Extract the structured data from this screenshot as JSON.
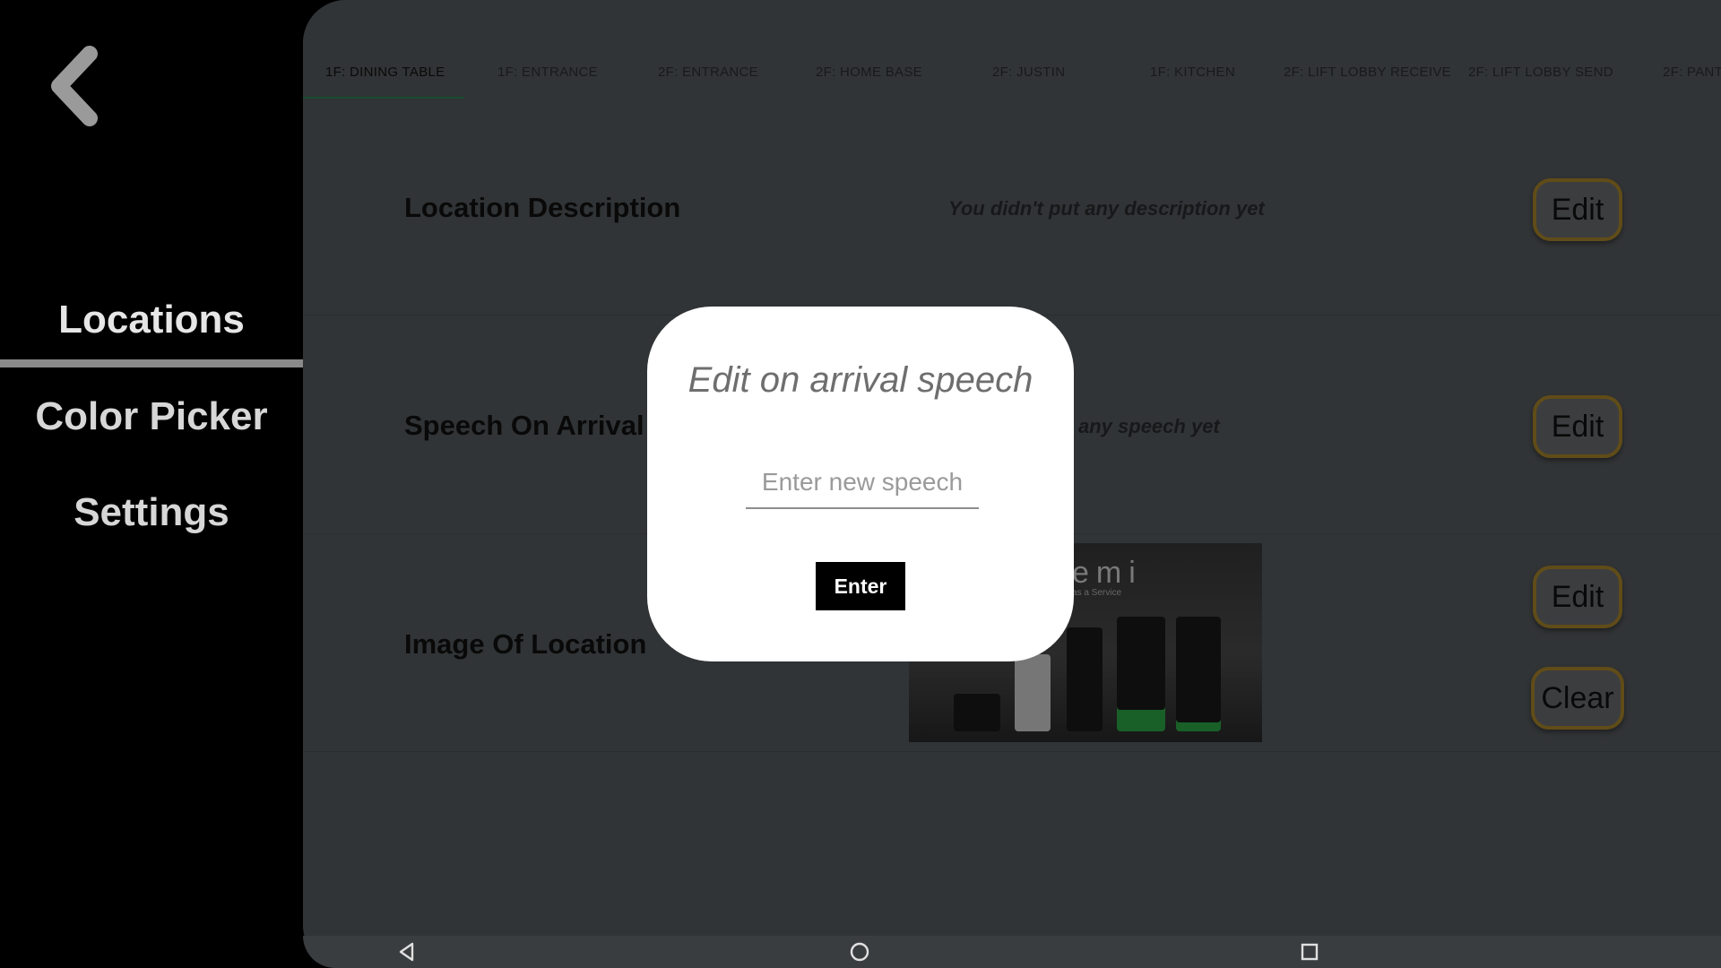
{
  "sidebar": {
    "items": [
      {
        "label": "Locations"
      },
      {
        "label": "Color Picker"
      },
      {
        "label": "Settings"
      }
    ]
  },
  "tabs": [
    {
      "label": "1F: Dining Table"
    },
    {
      "label": "1F: Entrance"
    },
    {
      "label": "2F: Entrance"
    },
    {
      "label": "2F: Home Base"
    },
    {
      "label": "2F: Justin"
    },
    {
      "label": "1F: Kitchen"
    },
    {
      "label": "2F: Lift Lobby Receive"
    },
    {
      "label": "2F: Lift Lobby Send"
    },
    {
      "label": "2F: Pant"
    }
  ],
  "rows": {
    "description": {
      "label": "Location Description",
      "value": "You didn't put any description yet",
      "edit_label": "Edit"
    },
    "speech": {
      "label": "Speech On Arrival",
      "value": "any speech yet",
      "edit_label": "Edit"
    },
    "image": {
      "label": "Image Of Location",
      "edit_label": "Edit",
      "clear_label": "Clear",
      "image_text": "emi",
      "image_subtext": "as a Service"
    }
  },
  "dialog": {
    "title": "Edit on arrival speech",
    "input_placeholder": "Enter new speech",
    "input_value": "",
    "button_label": "Enter"
  },
  "colors": {
    "accent": "#2e8b57",
    "button_border": "#b08a2d"
  },
  "icons": {
    "back": "chevron-left-icon",
    "nav_back": "triangle-back-icon",
    "nav_home": "circle-home-icon",
    "nav_recents": "square-recents-icon"
  }
}
